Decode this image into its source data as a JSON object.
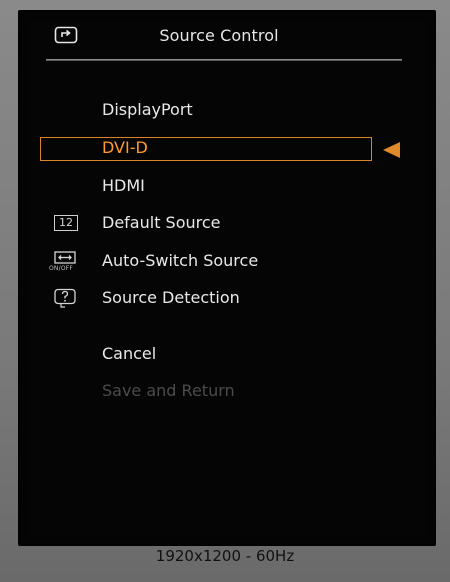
{
  "osd": {
    "title": "Source Control",
    "title_icon": "input-source-icon",
    "menu": [
      {
        "label": "DisplayPort",
        "state": "normal",
        "icon": null
      },
      {
        "label": "DVI-D",
        "state": "selected",
        "icon": null
      },
      {
        "label": "HDMI",
        "state": "normal",
        "icon": null
      },
      {
        "label": "Default Source",
        "state": "normal",
        "icon": "default-source-icon",
        "icon_text": "12"
      },
      {
        "label": "Auto-Switch Source",
        "state": "normal",
        "icon": "auto-switch-icon",
        "icon_text": "ON/OFF"
      },
      {
        "label": "Source Detection",
        "state": "normal",
        "icon": "source-detection-icon"
      },
      {
        "label": "Cancel",
        "state": "normal",
        "icon": null
      },
      {
        "label": "Save and Return",
        "state": "disabled",
        "icon": null
      }
    ],
    "selection_indicator": "left-arrow-icon"
  },
  "status_bar": {
    "resolution": "1920x1200 - 60Hz"
  },
  "colors": {
    "osd_background": "#050505",
    "text": "#e9e9e9",
    "selected_text": "#ff9a2e",
    "selection_border": "#d98527",
    "disabled_text": "#4b4b4b",
    "bezel": "#7a7a7a"
  }
}
